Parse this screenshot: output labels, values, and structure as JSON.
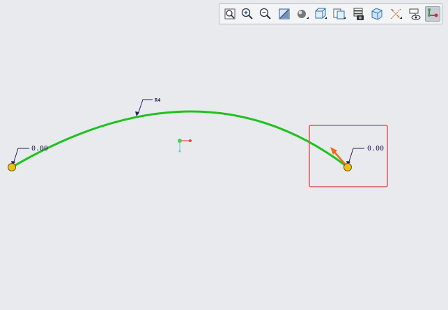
{
  "toolbar": {
    "buttons": [
      {
        "icon": "zoom-fit-icon"
      },
      {
        "icon": "zoom-in-icon"
      },
      {
        "icon": "zoom-out-icon"
      },
      {
        "icon": "repaint-icon"
      },
      {
        "icon": "display-style-icon"
      },
      {
        "icon": "saved-views-icon"
      },
      {
        "icon": "view-manager-icon"
      },
      {
        "icon": "layers-icon"
      },
      {
        "icon": "camera-icon"
      },
      {
        "icon": "perspective-view-icon"
      },
      {
        "icon": "datum-display-icon"
      },
      {
        "icon": "annotation-display-icon"
      },
      {
        "icon": "sketch-display-icon"
      }
    ]
  },
  "sketch": {
    "left_label": "0.00",
    "right_label": "0.00",
    "top_label": "R4",
    "curve_color": "#1fc21f",
    "point_color": "#f2be16",
    "highlight_color": "#e0545a",
    "tangent_color": "#f06a1a",
    "dim_color": "#2a1a5e"
  }
}
